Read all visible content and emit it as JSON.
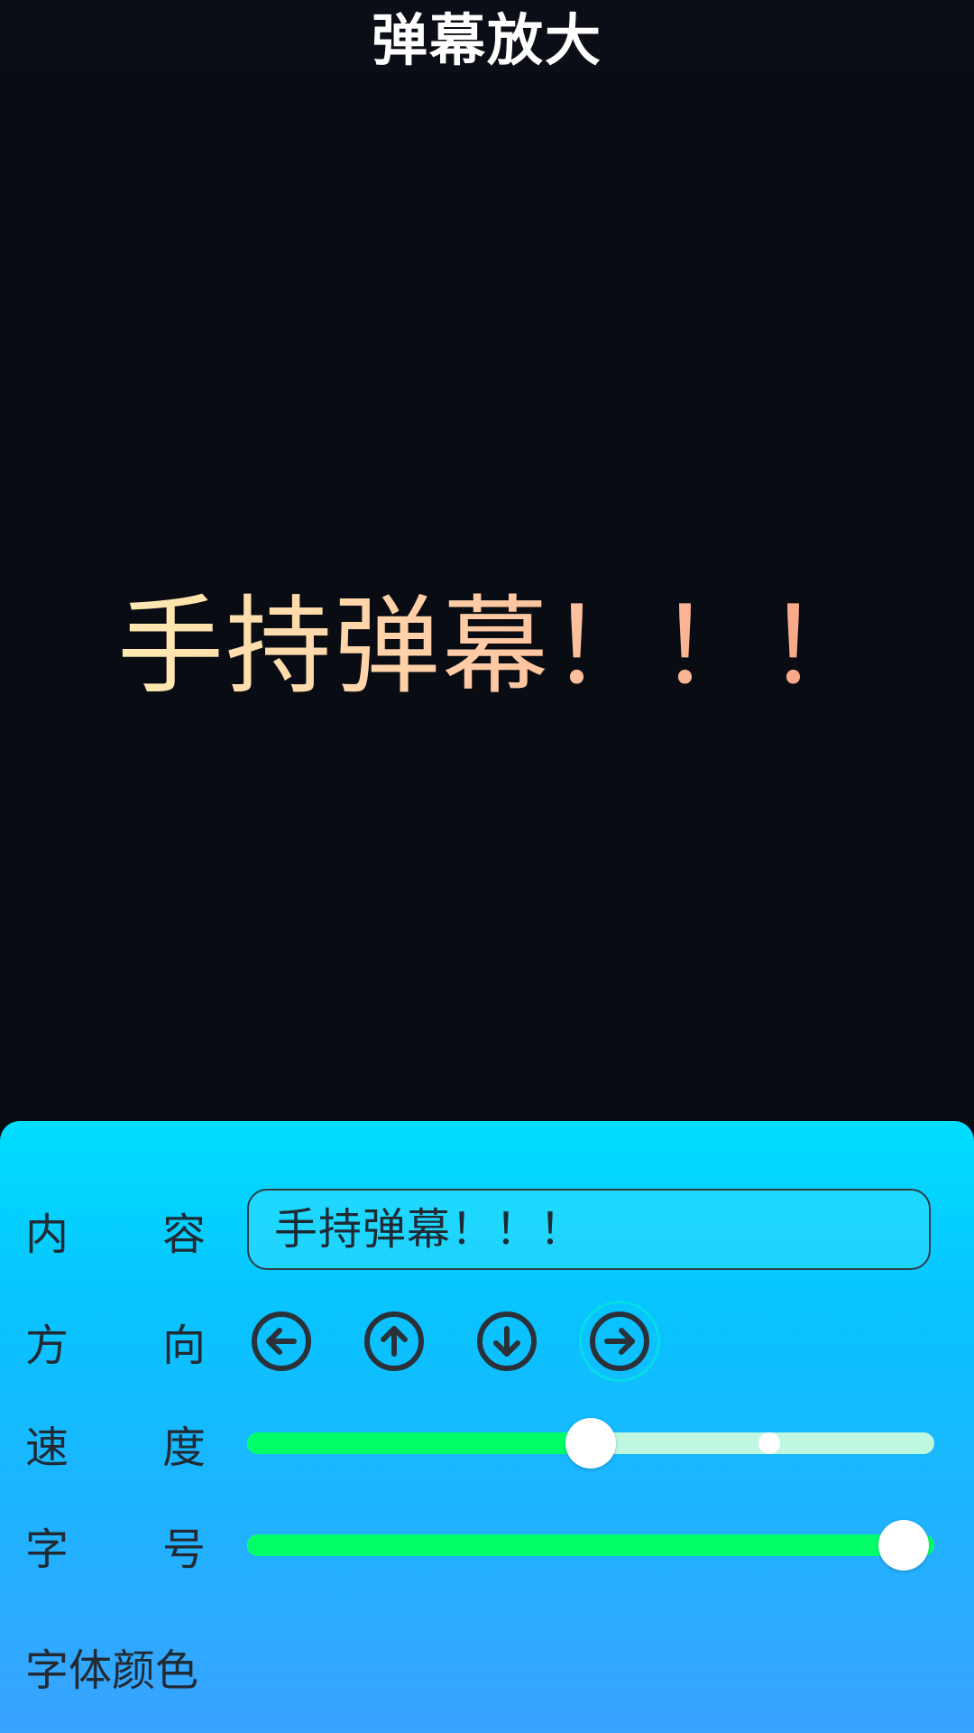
{
  "header": {
    "title": "弹幕放大"
  },
  "stage": {
    "danmaku_text": "手持弹幕！！！",
    "gradient_colors": [
      "#ffe9b0",
      "#ffd0a8",
      "#f7a184"
    ]
  },
  "panel": {
    "content": {
      "label_left": "内",
      "label_right": "容",
      "value": "手持弹幕！！！"
    },
    "direction": {
      "label_left": "方",
      "label_right": "向",
      "buttons": [
        {
          "icon": "arrow-left-circle-icon",
          "selected": false
        },
        {
          "icon": "arrow-up-circle-icon",
          "selected": false
        },
        {
          "icon": "arrow-down-circle-icon",
          "selected": false
        },
        {
          "icon": "arrow-right-circle-icon",
          "selected": true
        }
      ]
    },
    "speed": {
      "label_left": "速",
      "label_right": "度",
      "value_fraction": 0.5,
      "buffer_fraction": 0.76
    },
    "font_size": {
      "label_left": "字",
      "label_right": "号",
      "value_fraction": 1.0
    },
    "font_color": {
      "label": "字体颜色"
    }
  },
  "colors": {
    "background": "#0a0c14",
    "panel_top": "#00ddff",
    "panel_bottom": "#3aa2ff",
    "slider_active": "#00ff66",
    "slider_inactive": "#bff8e0"
  }
}
